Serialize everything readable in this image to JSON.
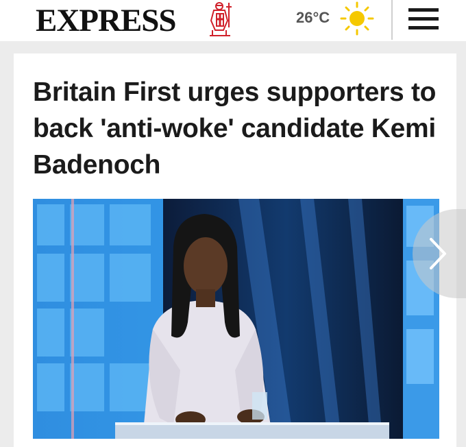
{
  "header": {
    "logo_text": "EXPRESS",
    "logo_icon": "crusader-knight-icon",
    "temperature": "26°C",
    "weather_icon": "sun-icon",
    "menu_icon": "hamburger-menu-icon"
  },
  "article": {
    "headline": "Britain First urges supporters to back 'anti-woke' candidate Kemi Badenoch",
    "image_icon": "photo",
    "next_icon": "chevron-right-icon"
  },
  "colors": {
    "brand_red": "#d0202a",
    "sun_yellow": "#f5c800",
    "headline": "#1b1b1b",
    "studio_blue": "#2f8ee0"
  }
}
